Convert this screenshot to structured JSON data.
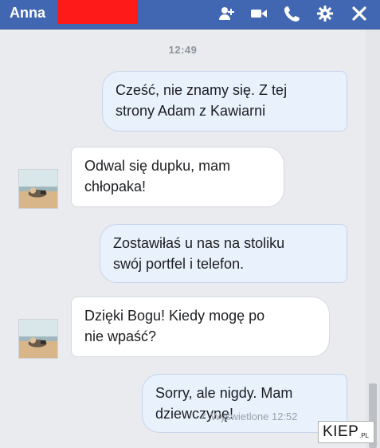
{
  "header": {
    "name": "Anna",
    "icons": [
      "add-person-icon",
      "video-camera-icon",
      "phone-icon",
      "gear-icon",
      "close-icon"
    ],
    "color": "#4267b2",
    "redaction_color": "#ff1a1a"
  },
  "chat": {
    "timestamp": "12:49",
    "messages": [
      {
        "direction": "out",
        "lines": [
          "Cześć, nie znamy się. Z tej",
          "strony Adam z Kawiarni"
        ]
      },
      {
        "direction": "in",
        "lines": [
          "Odwal się dupku, mam",
          "chłopaka!"
        ]
      },
      {
        "direction": "out",
        "lines": [
          "Zostawiłaś u nas na stoliku",
          "swój portfel i telefon."
        ]
      },
      {
        "direction": "in",
        "lines": [
          "Dzięki Bogu! Kiedy mogę po",
          "nie wpaść?"
        ]
      },
      {
        "direction": "out",
        "lines": [
          "Sorry, ale nigdy. Mam",
          "dziewczynę!"
        ]
      }
    ],
    "seen_status": "✓ Wyświetlone 12:52"
  },
  "watermark": {
    "main": "KIEP",
    "tld": ".PL"
  }
}
